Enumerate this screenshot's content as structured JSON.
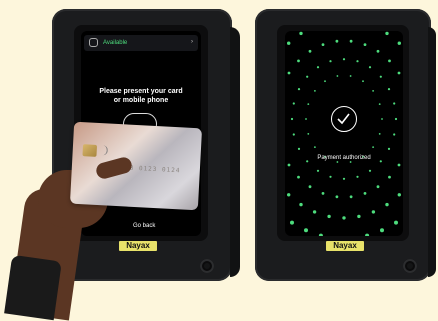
{
  "left_terminal": {
    "status_label": "Available",
    "prompt": "Please present your card\nor mobile phone",
    "go_back_label": "Go back",
    "brand": "Nayax"
  },
  "right_terminal": {
    "auth_message": "Payment authorized",
    "brand": "Nayax"
  },
  "card": {
    "number_fragment": "5678 0123 0124"
  },
  "colors": {
    "background": "#fdf6dc",
    "accent_green": "#4ddc7d",
    "brand_label": "#e8e26a"
  }
}
